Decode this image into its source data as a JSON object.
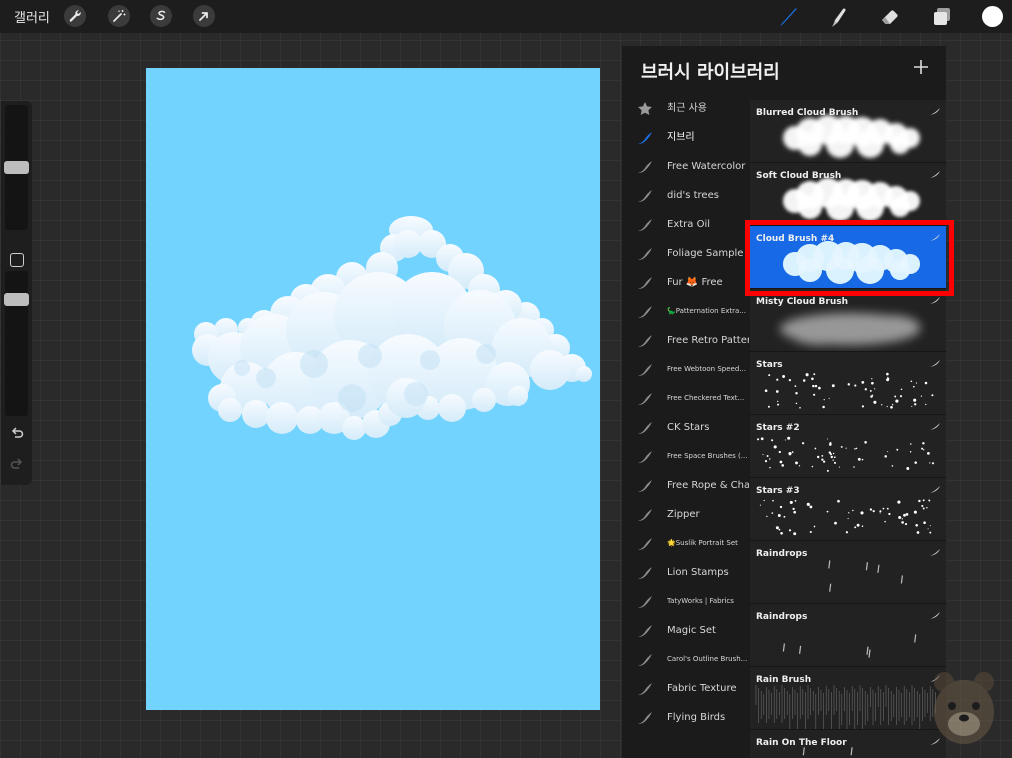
{
  "topbar": {
    "gallery_label": "갤러리",
    "left_tools": [
      {
        "name": "actions",
        "icon": "wrench-icon"
      },
      {
        "name": "adjustments",
        "icon": "magic-wand-icon"
      },
      {
        "name": "selection",
        "icon": "selection-s-icon"
      },
      {
        "name": "transform",
        "icon": "arrow-cursor-icon"
      }
    ],
    "right_tools": [
      {
        "name": "brush",
        "icon": "brush-icon",
        "active": true
      },
      {
        "name": "smudge",
        "icon": "smudge-icon"
      },
      {
        "name": "eraser",
        "icon": "eraser-icon"
      },
      {
        "name": "layers",
        "icon": "layers-icon"
      }
    ],
    "accent_color": "#1a73e8",
    "current_color": "#ffffff"
  },
  "sidebar": {
    "brush_size_level": 0.5,
    "opacity_level": 0.83
  },
  "canvas": {
    "background_color": "#72d4fe"
  },
  "brush_library": {
    "title": "브러시 라이브러리",
    "sets": [
      {
        "label": "최근 사용",
        "icon": "star-icon"
      },
      {
        "label": "지브리",
        "icon": "brush-stroke-icon",
        "active": true
      },
      {
        "label": "Free Watercolor",
        "icon": "brush-stroke-icon"
      },
      {
        "label": "did's trees",
        "icon": "brush-stroke-icon"
      },
      {
        "label": "Extra Oil",
        "icon": "brush-stroke-icon"
      },
      {
        "label": "Foliage Sample",
        "icon": "brush-stroke-icon"
      },
      {
        "label": "Fur 🦊 Free",
        "icon": "brush-stroke-icon"
      },
      {
        "label": "🦕Patternation Extra...",
        "icon": "brush-stroke-icon",
        "small": true
      },
      {
        "label": "Free Retro Pattern",
        "icon": "brush-stroke-icon"
      },
      {
        "label": "Free Webtoon Speed...",
        "icon": "brush-stroke-icon",
        "small": true
      },
      {
        "label": "Free Checkered Text...",
        "icon": "brush-stroke-icon",
        "small": true
      },
      {
        "label": "CK Stars",
        "icon": "brush-stroke-icon"
      },
      {
        "label": "Free Space Brushes (...",
        "icon": "brush-stroke-icon",
        "small": true
      },
      {
        "label": "Free Rope & Chain",
        "icon": "brush-stroke-icon"
      },
      {
        "label": "Zipper",
        "icon": "brush-stroke-icon"
      },
      {
        "label": "🌟Suslik Portrait Set",
        "icon": "brush-stroke-icon",
        "small": true
      },
      {
        "label": "Lion Stamps",
        "icon": "brush-stroke-icon"
      },
      {
        "label": "TatyWorks | Fabrics",
        "icon": "brush-stroke-icon",
        "small": true
      },
      {
        "label": "Magic Set",
        "icon": "brush-stroke-icon"
      },
      {
        "label": "Carol's Outline Brush...",
        "icon": "brush-stroke-icon",
        "small": true
      },
      {
        "label": "Fabric Texture",
        "icon": "brush-stroke-icon"
      },
      {
        "label": "Flying Birds",
        "icon": "brush-stroke-icon"
      }
    ],
    "brushes": [
      {
        "name": "Blurred Cloud Brush",
        "kind": "cloud"
      },
      {
        "name": "Soft Cloud Brush",
        "kind": "cloud"
      },
      {
        "name": "Cloud Brush #4",
        "kind": "cloud4",
        "selected": true
      },
      {
        "name": "Misty Cloud Brush",
        "kind": "mist"
      },
      {
        "name": "Stars",
        "kind": "stars"
      },
      {
        "name": "Stars #2",
        "kind": "stars"
      },
      {
        "name": "Stars #3",
        "kind": "stars"
      },
      {
        "name": "Raindrops",
        "kind": "rain"
      },
      {
        "name": "Raindrops",
        "kind": "rain"
      },
      {
        "name": "Rain Brush",
        "kind": "rainbrush"
      },
      {
        "name": "Rain On The Floor",
        "kind": "rain"
      }
    ],
    "selection_highlight_color": "#ff0000"
  }
}
